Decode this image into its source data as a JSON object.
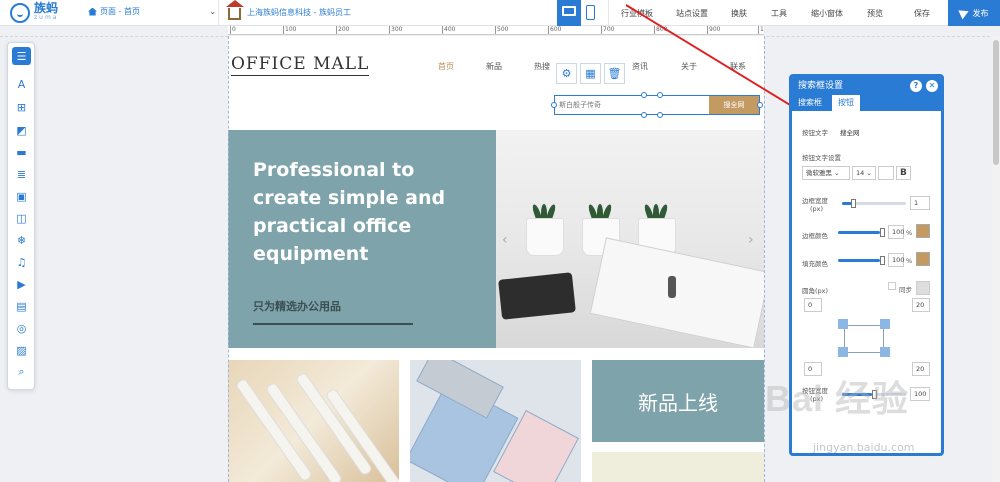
{
  "app": {
    "logo_cn": "族蚂",
    "logo_en": "zuma",
    "page_selector": "页面 - 首页",
    "site_name": "上海族蚂信息科技 - 族蚂员工"
  },
  "menu": [
    "行业模板",
    "站点设置",
    "换肤",
    "工具",
    "缩小窗体",
    "预览",
    "保存"
  ],
  "publish_label": "发布",
  "ruler": [
    "0",
    "100",
    "200",
    "300",
    "400",
    "500",
    "600",
    "700",
    "800",
    "900",
    "1000"
  ],
  "site": {
    "logo": "OFFICE MALL",
    "nav": [
      "首页",
      "新品",
      "热搜",
      "资讯",
      "关于",
      "联系"
    ],
    "hero_title": "Professional to create simple and practical office equipment",
    "hero_sub": "只为精选办公用品",
    "tile_new": "新品上线",
    "search_placeholder": "斯白般子传奇",
    "search_button": "搜全网"
  },
  "panel": {
    "title": "搜索框设置",
    "tabs": [
      "搜索框",
      "按钮"
    ],
    "button_text_label": "按钮文字",
    "button_text_value": "搜全网",
    "font_settings_label": "按钮文字设置",
    "font_family": "微软雅黑",
    "font_size": "14",
    "bold": "B",
    "border_width_label": "边框宽度",
    "border_width_unit": "(px)",
    "border_width_value": "1",
    "border_color_label": "边框颜色",
    "border_color_value": "100",
    "fill_color_label": "填充颜色",
    "fill_color_value": "100",
    "percent": "%",
    "radius_label": "圆角(px)",
    "sync_label": "同步",
    "radius_tl": "0",
    "radius_tr": "20",
    "radius_bl": "0",
    "radius_br": "20",
    "button_width_label": "按钮宽度",
    "button_width_value": "100",
    "button_height_label": "(px)",
    "accent": "#2a7bd4",
    "swatch": "#c49a63"
  },
  "watermark": {
    "brand": "Bai 经验",
    "url": "jingyan.baidu.com"
  }
}
